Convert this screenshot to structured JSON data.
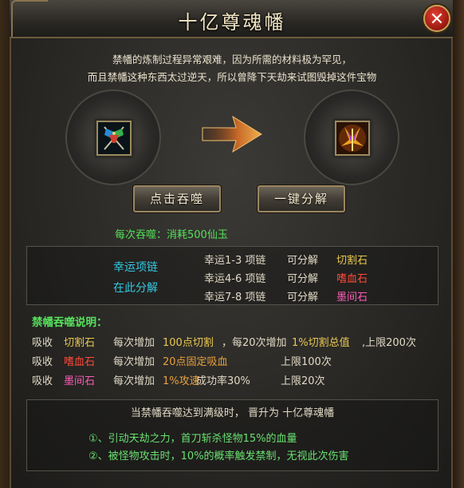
{
  "window": {
    "title": "十亿尊魂幡",
    "close_icon": "close-icon"
  },
  "intro": {
    "line1": "禁幡的炼制过程异常艰难，因为所需的材料极为罕见，",
    "line2": "而且禁幡这种东西太过逆天，所以曾降下天劫来试图毁掉这件宝物"
  },
  "slots": {
    "left_icon": "banner-item-icon",
    "right_icon": "banner-item-upgraded-icon",
    "arrow_icon": "arrow-right-icon"
  },
  "buttons": {
    "devour_label": "点击吞噬",
    "decompose_label": "一键分解"
  },
  "cost_text": "每次吞噬：消耗500仙玉",
  "lucky": {
    "title_line1": "幸运项链",
    "title_line2": "在此分解",
    "rows": [
      {
        "item": "幸运1-3 项链",
        "action": "可分解",
        "result": "切割石",
        "color": "#e8c850"
      },
      {
        "item": "幸运4-6 项链",
        "action": "可分解",
        "result": "嗜血石",
        "color": "#ff4a3a"
      },
      {
        "item": "幸运7-8 项链",
        "action": "可分解",
        "result": "墨间石",
        "color": "#ff5ab8"
      }
    ]
  },
  "rules": {
    "title": "禁幡吞噬说明：",
    "rows": [
      {
        "prefix": "吸收",
        "stone": "切割石",
        "stone_color": "#e8c850",
        "desc_a": "每次增加",
        "desc_b": "100点切割",
        "desc_b_color": "#e8c850",
        "desc_c": "，每20次增加",
        "desc_d": "1%切割总值",
        "desc_d_color": "#e8c850",
        "desc_e": ",上限200次"
      },
      {
        "prefix": "吸收",
        "stone": "嗜血石",
        "stone_color": "#ff4a3a",
        "desc_a": "每次增加",
        "desc_b": "20点固定吸血",
        "desc_b_color": "#e8a03c",
        "limit": "上限100次"
      },
      {
        "prefix": "吸收",
        "stone": "墨间石",
        "stone_color": "#ff5ab8",
        "desc_a": "每次增加",
        "desc_b": "1%攻速",
        "desc_b_color": "#e8a03c",
        "desc_c": "成功率30%",
        "limit": "上限20次"
      }
    ]
  },
  "upgrade": {
    "text": "当禁幡吞噬达到满级时，  晋升为 十亿尊魂幡",
    "effects": [
      "①、引动天劫之力，首刀斩杀怪物15%的血量",
      "②、被怪物攻击时，10%的概率触发禁制，无视此次伤害"
    ]
  }
}
